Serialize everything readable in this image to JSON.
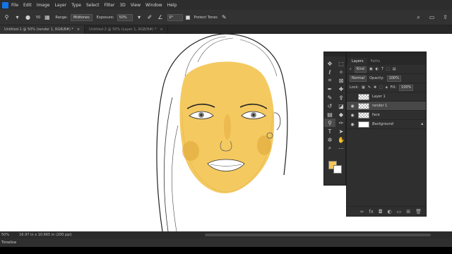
{
  "menu": {
    "items": [
      "File",
      "Edit",
      "Image",
      "Layer",
      "Type",
      "Select",
      "Filter",
      "3D",
      "View",
      "Window",
      "Help"
    ]
  },
  "options": {
    "brush_size": "50",
    "range_label": "Range:",
    "range_value": "Midtones",
    "exposure_label": "Exposure:",
    "exposure_value": "50%",
    "angle_value": "0°",
    "protect_tones_label": "Protect Tones"
  },
  "tabs": [
    {
      "label": "Untitled-1 @ 50% (render 1, RGB/8#) *"
    },
    {
      "label": "Untitled-2 @ 50% (Layer 1, RGB/8#) *"
    }
  ],
  "layers_panel": {
    "tabs": [
      "Layers",
      "Paths"
    ],
    "kind_label": "Kind",
    "blend_mode": "Normal",
    "opacity_label": "Opacity:",
    "opacity_value": "100%",
    "lock_label": "Lock:",
    "fill_label": "Fill:",
    "fill_value": "100%",
    "layers": [
      {
        "name": "Layer 1",
        "visible": false,
        "selected": false
      },
      {
        "name": "render 1",
        "visible": true,
        "selected": true
      },
      {
        "name": "face",
        "visible": true,
        "selected": false
      },
      {
        "name": "Background",
        "visible": true,
        "selected": false
      }
    ]
  },
  "colors": {
    "foreground": "#f3c657",
    "background": "#ffffff"
  },
  "status": {
    "zoom": "50%",
    "doc_size": "16.97 in x 10.665 in (200 ppi)"
  },
  "timeline": {
    "label": "Timeline"
  }
}
